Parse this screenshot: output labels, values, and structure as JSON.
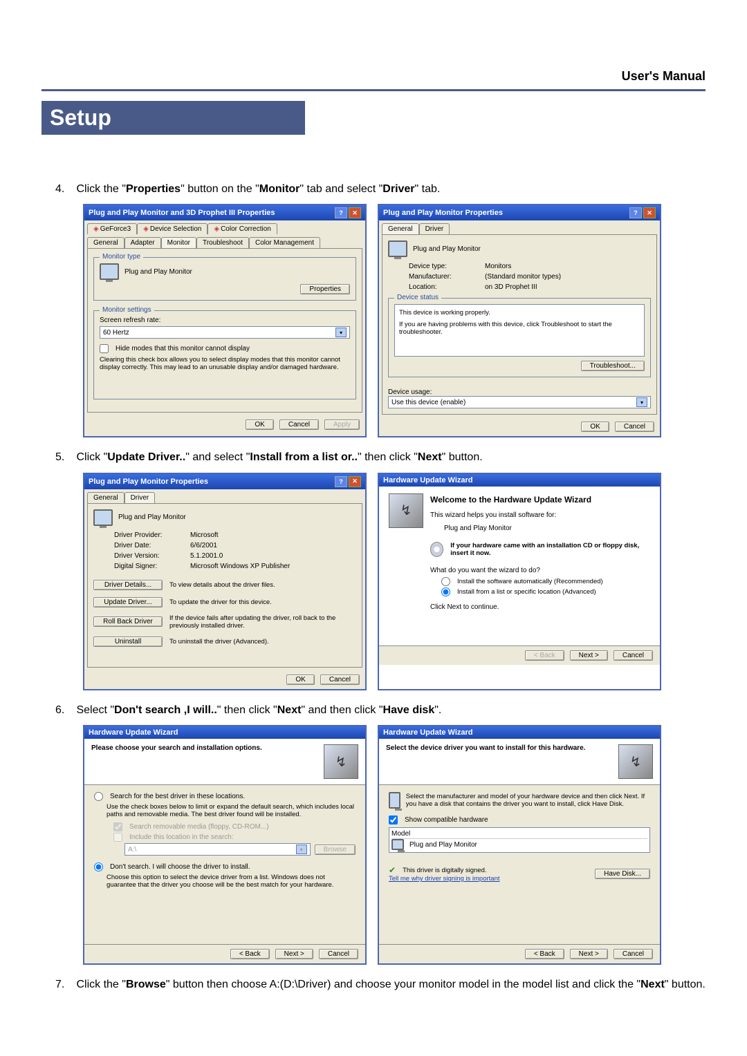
{
  "header": {
    "manual": "User's Manual"
  },
  "section": {
    "title": "Setup"
  },
  "steps": {
    "s4_a": "Click the \"",
    "s4_b": "Properties",
    "s4_c": "\" button on the \"",
    "s4_d": "Monitor",
    "s4_e": "\" tab and select \"",
    "s4_f": "Driver",
    "s4_g": "\" tab.",
    "s5_a": "Click \"",
    "s5_b": "Update Driver..",
    "s5_c": "\" and select \"",
    "s5_d": "Install from a list or..",
    "s5_e": "\" then click \"",
    "s5_f": "Next",
    "s5_g": "\" button.",
    "s6_a": "Select \"",
    "s6_b": "Don't search ,I will..",
    "s6_c": "\" then click \"",
    "s6_d": "Next",
    "s6_e": "\" and then click \"",
    "s6_f": "Have disk",
    "s6_g": "\".",
    "s7": "Click the \"Browse\" button then choose A:(D:\\Driver) and choose your monitor model in the model list and click the \"Next\" button.",
    "s7_b1": "Browse",
    "s7_b2": "Next"
  },
  "dlg1": {
    "title": "Plug and Play Monitor and 3D Prophet III Properties",
    "tabs_top": [
      "GeForce3",
      "Device Selection",
      "Color Correction"
    ],
    "tabs_bot": [
      "General",
      "Adapter",
      "Monitor",
      "Troubleshoot",
      "Color Management"
    ],
    "group_monitor_type": "Monitor type",
    "device": "Plug and Play Monitor",
    "properties_btn": "Properties",
    "group_monitor_settings": "Monitor settings",
    "refresh_label": "Screen refresh rate:",
    "refresh_value": "60 Hertz",
    "hide_modes": "Hide modes that this monitor cannot display",
    "hide_help": "Clearing this check box allows you to select display modes that this monitor cannot display correctly. This may lead to an unusable display and/or damaged hardware.",
    "ok": "OK",
    "cancel": "Cancel",
    "apply": "Apply"
  },
  "dlg2": {
    "title": "Plug and Play Monitor Properties",
    "tabs": [
      "General",
      "Driver"
    ],
    "device": "Plug and Play Monitor",
    "devtype_l": "Device type:",
    "devtype_v": "Monitors",
    "manu_l": "Manufacturer:",
    "manu_v": "(Standard monitor types)",
    "loc_l": "Location:",
    "loc_v": "on 3D Prophet III",
    "status_legend": "Device status",
    "status_line1": "This device is working properly.",
    "status_line2": "If you are having problems with this device, click Troubleshoot to start the troubleshooter.",
    "troubleshoot": "Troubleshoot...",
    "usage_l": "Device usage:",
    "usage_v": "Use this device (enable)",
    "ok": "OK",
    "cancel": "Cancel"
  },
  "dlg3": {
    "title": "Plug and Play Monitor Properties",
    "tabs": [
      "General",
      "Driver"
    ],
    "device": "Plug and Play Monitor",
    "prov_l": "Driver Provider:",
    "prov_v": "Microsoft",
    "date_l": "Driver Date:",
    "date_v": "6/6/2001",
    "ver_l": "Driver Version:",
    "ver_v": "5.1.2001.0",
    "sign_l": "Digital Signer:",
    "sign_v": "Microsoft Windows XP Publisher",
    "b_details": "Driver Details...",
    "b_details_d": "To view details about the driver files.",
    "b_update": "Update Driver...",
    "b_update_d": "To update the driver for this device.",
    "b_roll": "Roll Back Driver",
    "b_roll_d": "If the device fails after updating the driver, roll back to the previously installed driver.",
    "b_uninst": "Uninstall",
    "b_uninst_d": "To uninstall the driver (Advanced).",
    "ok": "OK",
    "cancel": "Cancel"
  },
  "wiz1": {
    "title": "Hardware Update Wizard",
    "welcome": "Welcome to the Hardware Update Wizard",
    "helps": "This wizard helps you install software for:",
    "device": "Plug and Play Monitor",
    "cd_hint": "If your hardware came with an installation CD or floppy disk, insert it now.",
    "q": "What do you want the wizard to do?",
    "opt1": "Install the software automatically (Recommended)",
    "opt2": "Install from a list or specific location (Advanced)",
    "cont": "Click Next to continue.",
    "back": "< Back",
    "next": "Next >",
    "cancel": "Cancel"
  },
  "wiz2": {
    "title": "Hardware Update Wizard",
    "head": "Please choose your search and installation options.",
    "opt1": "Search for the best driver in these locations.",
    "opt1_help": "Use the check boxes below to limit or expand the default search, which includes local paths and removable media. The best driver found will be installed.",
    "chk1": "Search removable media (floppy, CD-ROM...)",
    "chk2": "Include this location in the search:",
    "path": "A:\\",
    "browse": "Browse",
    "opt2": "Don't search. I will choose the driver to install.",
    "opt2_help": "Choose this option to select the device driver from a list. Windows does not guarantee that the driver you choose will be the best match for your hardware.",
    "back": "< Back",
    "next": "Next >",
    "cancel": "Cancel"
  },
  "wiz3": {
    "title": "Hardware Update Wizard",
    "head": "Select the device driver you want to install for this hardware.",
    "intro": "Select the manufacturer and model of your hardware device and then click Next. If you have a disk that contains the driver you want to install, click Have Disk.",
    "show_compat": "Show compatible hardware",
    "model_l": "Model",
    "model_v": "Plug and Play Monitor",
    "signed": "This driver is digitally signed.",
    "why": "Tell me why driver signing is important",
    "havedisk": "Have Disk...",
    "back": "< Back",
    "next": "Next >",
    "cancel": "Cancel"
  }
}
